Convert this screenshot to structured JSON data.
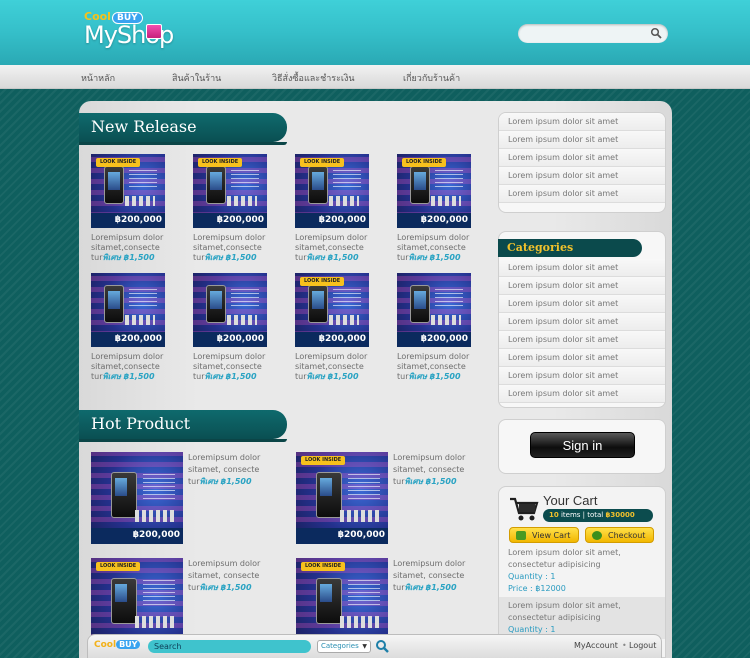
{
  "brand": {
    "small_prefix": "Cool",
    "small_badge": "BUY",
    "name": "MyShop"
  },
  "search": {
    "placeholder": ""
  },
  "nav": [
    {
      "label": "หน้าหลัก"
    },
    {
      "label": "สินค้าในร้าน"
    },
    {
      "label": "วิธีสั่งซื้อและชำระเงิน"
    },
    {
      "label": "เกี่ยวกับร้านค้า"
    }
  ],
  "new_release": {
    "title": "New Release",
    "items": [
      {
        "price": "฿200,000",
        "look": "LOOK INSIDE",
        "desc1": "Loremipsum dolor",
        "desc2": "sitamet,consecte",
        "desc3": "tur",
        "sale": "พิเศษ ฿1,500"
      },
      {
        "price": "฿200,000",
        "look": "LOOK INSIDE",
        "desc1": "Loremipsum dolor",
        "desc2": "sitamet,consecte",
        "desc3": "tur",
        "sale": "พิเศษ ฿1,500"
      },
      {
        "price": "฿200,000",
        "look": "LOOK INSIDE",
        "desc1": "Loremipsum dolor",
        "desc2": "sitamet,consecte",
        "desc3": "tur",
        "sale": "พิเศษ ฿1,500"
      },
      {
        "price": "฿200,000",
        "look": "LOOK INSIDE",
        "desc1": "Loremipsum dolor",
        "desc2": "sitamet,consecte",
        "desc3": "tur",
        "sale": "พิเศษ ฿1,500"
      },
      {
        "price": "฿200,000",
        "look": "",
        "desc1": "Loremipsum dolor",
        "desc2": "sitamet,consecte",
        "desc3": "tur",
        "sale": "พิเศษ ฿1,500"
      },
      {
        "price": "฿200,000",
        "look": "",
        "desc1": "Loremipsum dolor",
        "desc2": "sitamet,consecte",
        "desc3": "tur",
        "sale": "พิเศษ ฿1,500"
      },
      {
        "price": "฿200,000",
        "look": "LOOK INSIDE",
        "desc1": "Loremipsum dolor",
        "desc2": "sitamet,consecte",
        "desc3": "tur",
        "sale": "พิเศษ ฿1,500"
      },
      {
        "price": "฿200,000",
        "look": "",
        "desc1": "Loremipsum dolor",
        "desc2": "sitamet,consecte",
        "desc3": "tur",
        "sale": "พิเศษ ฿1,500"
      }
    ]
  },
  "hot_product": {
    "title": "Hot Product",
    "items": [
      {
        "price": "฿200,000",
        "look": "",
        "desc1": "Loremipsum dolor",
        "desc2": "sitamet, consecte",
        "desc3": "tur",
        "sale": "พิเศษ ฿1,500"
      },
      {
        "price": "฿200,000",
        "look": "LOOK INSIDE",
        "desc1": "Loremipsum dolor",
        "desc2": "sitamet, consecte",
        "desc3": "tur",
        "sale": "พิเศษ ฿1,500"
      },
      {
        "price": "",
        "look": "LOOK INSIDE",
        "desc1": "Loremipsum dolor",
        "desc2": "sitamet, consecte",
        "desc3": "tur",
        "sale": "พิเศษ ฿1,500"
      },
      {
        "price": "",
        "look": "LOOK INSIDE",
        "desc1": "Loremipsum dolor",
        "desc2": "sitamet, consecte",
        "desc3": "tur",
        "sale": "พิเศษ ฿1,500"
      }
    ]
  },
  "sidebar_links": [
    "Lorem ipsum dolor sit amet",
    "Lorem ipsum dolor sit amet",
    "Lorem ipsum dolor sit amet",
    "Lorem ipsum dolor sit amet",
    "Lorem ipsum dolor sit amet"
  ],
  "categories": {
    "title": "Categories",
    "items": [
      "Lorem ipsum dolor sit amet",
      "Lorem ipsum dolor sit amet",
      "Lorem ipsum dolor sit amet",
      "Lorem ipsum dolor sit amet",
      "Lorem ipsum dolor sit amet",
      "Lorem ipsum dolor sit amet",
      "Lorem ipsum dolor sit amet",
      "Lorem ipsum dolor sit amet"
    ]
  },
  "signin": {
    "label": "Sign in"
  },
  "cart": {
    "title": "Your Cart",
    "count": "10",
    "count_suffix": " items | total ",
    "total": "฿30000",
    "view_label": "View Cart",
    "checkout_label": "Checkout",
    "items": [
      {
        "line1": "Lorem ipsum dolor sit amet,",
        "line2": "consectetur adipisicing",
        "qty": "Quantity : 1",
        "price": "Price : ฿12000"
      },
      {
        "line1": "Lorem ipsum dolor sit amet,",
        "line2": "consectetur adipisicing",
        "qty": "Quantity : 1",
        "price": ""
      }
    ]
  },
  "bottombar": {
    "logo_prefix": "Cool",
    "logo_badge": "BUY",
    "search_label": "Search",
    "select_value": "Categories",
    "my_account": "MyAccount",
    "logout": "Logout"
  },
  "colors": {
    "header": "#3fd0d8",
    "background": "#0f5f5e",
    "section_title": "#0a4f52",
    "accent_yellow": "#f1c12c",
    "sale_blue": "#2aa3c3"
  },
  "icons": {
    "search": "search-icon",
    "cart": "cart-icon",
    "view_cart": "basket-icon",
    "checkout": "money-icon"
  }
}
